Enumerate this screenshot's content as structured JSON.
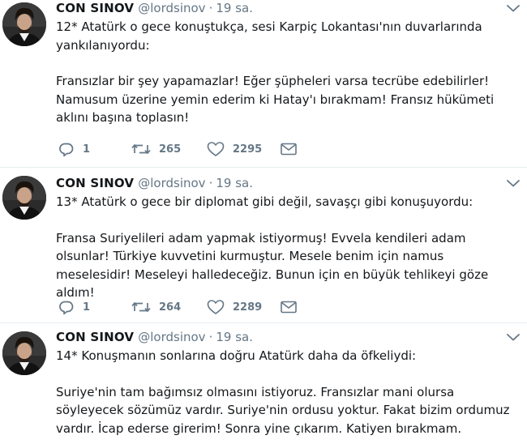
{
  "tweets": [
    {
      "name": "CON SINOV",
      "handle": "@lordsinov",
      "separator": "·",
      "time": "19 sa.",
      "paragraphs": [
        "12* Atatürk o gece konuştukça, sesi Karpiç Lokantası'nın duvarlarında yankılanıyordu:",
        "Fransızlar bir şey yapamazlar! Eğer şüpheleri varsa tecrübe edebilirler! Namusum üzerine yemin ederim ki Hatay'ı bırakmam! Fransız hükümeti aklını başına toplasın!"
      ],
      "replies": "1",
      "retweets": "265",
      "likes": "2295"
    },
    {
      "name": "CON SINOV",
      "handle": "@lordsinov",
      "separator": "·",
      "time": "19 sa.",
      "paragraphs": [
        "13* Atatürk o gece bir diplomat gibi değil, savaşçı gibi konuşuyordu:",
        "Fransa Suriyelileri adam yapmak istiyormuş! Evvela kendileri adam olsunlar! Türkiye kuvvetini kurmuştur. Mesele benim için namus meselesidir! Meseleyi halledeceğiz. Bunun için en büyük tehlikeyi göze aldım!"
      ],
      "replies": "1",
      "retweets": "264",
      "likes": "2289"
    },
    {
      "name": "CON SINOV",
      "handle": "@lordsinov",
      "separator": "·",
      "time": "19 sa.",
      "paragraphs": [
        "14* Konuşmanın sonlarına doğru Atatürk daha da öfkeliydi:",
        "Suriye'nin tam bağımsız olmasını istiyoruz. Fransızlar mani olursa söyleyecek sözümüz vardır. Suriye'nin ordusu yoktur. Fakat bizim ordumuz vardır. İcap ederse girerim! Sonra yine çıkarım. Katiyen bırakmam."
      ]
    }
  ],
  "icons": {
    "reply": "reply-icon",
    "retweet": "retweet-icon",
    "like": "heart-icon",
    "message": "direct-message-icon",
    "more": "chevron-down-icon"
  },
  "colors": {
    "text": "#14171a",
    "secondary": "#657786",
    "divider": "#e6ecf0"
  }
}
